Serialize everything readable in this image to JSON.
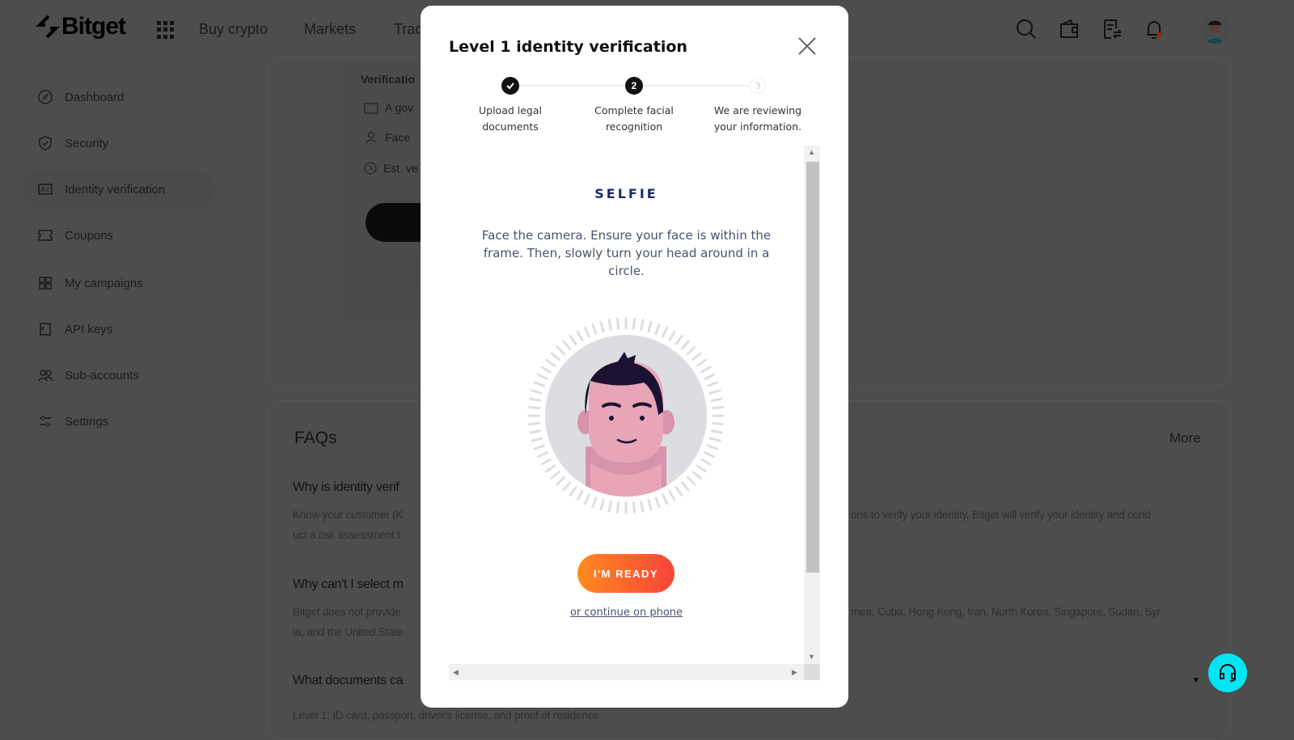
{
  "header": {
    "logo": "Bitget",
    "nav": [
      "Buy crypto",
      "Markets",
      "Trade"
    ],
    "icons": [
      "search-icon",
      "wallet-icon",
      "orders-icon",
      "bell-icon"
    ],
    "notification_dot_color": "#e5471d"
  },
  "sidebar": {
    "items": [
      {
        "label": "Dashboard",
        "icon": "compass-icon"
      },
      {
        "label": "Security",
        "icon": "shield-icon"
      },
      {
        "label": "Identity verification",
        "icon": "id-card-icon",
        "active": true
      },
      {
        "label": "Coupons",
        "icon": "ticket-icon"
      },
      {
        "label": "My campaigns",
        "icon": "grid-icon"
      },
      {
        "label": "API keys",
        "icon": "key-icon"
      },
      {
        "label": "Sub-accounts",
        "icon": "users-icon"
      },
      {
        "label": "Settings",
        "icon": "sliders-icon"
      }
    ]
  },
  "verification": {
    "heading": "Verificatio",
    "items": [
      "A gov",
      "Face",
      "Est. ve"
    ]
  },
  "faq": {
    "title": "FAQs",
    "more": "More",
    "items": [
      {
        "q": "Why is identity verif",
        "a1": "Know your customer (K",
        "a1r": "ons to verify your identity. Bitget will verify your identity and cond",
        "a2": "uct a risk assessment t"
      },
      {
        "q": "Why can't I select m",
        "a1": "Bitget does not provide",
        "a1r": "mea, Cuba, Hong Kong, Iran, North Korea, Singapore, Sudan, Syr",
        "a2": "ia, and the United State"
      },
      {
        "q": "What documents ca",
        "a1": "Level 1: ID card, passport, driver's license, and proof of residence."
      }
    ]
  },
  "modal": {
    "title": "Level 1 identity verification",
    "steps": [
      {
        "label": "Upload legal documents",
        "state": "done"
      },
      {
        "num": "2",
        "label": "Complete facial recognition",
        "state": "current"
      },
      {
        "num": "3",
        "label": "We are reviewing your information.",
        "state": "pending"
      }
    ],
    "selfie": {
      "heading": "SELFIE",
      "instructions": "Face the camera. Ensure your face is within the frame. Then, slowly turn your head around in a circle.",
      "ready_button": "I'M READY",
      "phone_link": "or continue on phone"
    }
  },
  "colors": {
    "accent_gradient": [
      "#ff8a1f",
      "#f7443a"
    ],
    "help_button": "#00e5f2",
    "selfie_heading": "#1e2a6b"
  }
}
